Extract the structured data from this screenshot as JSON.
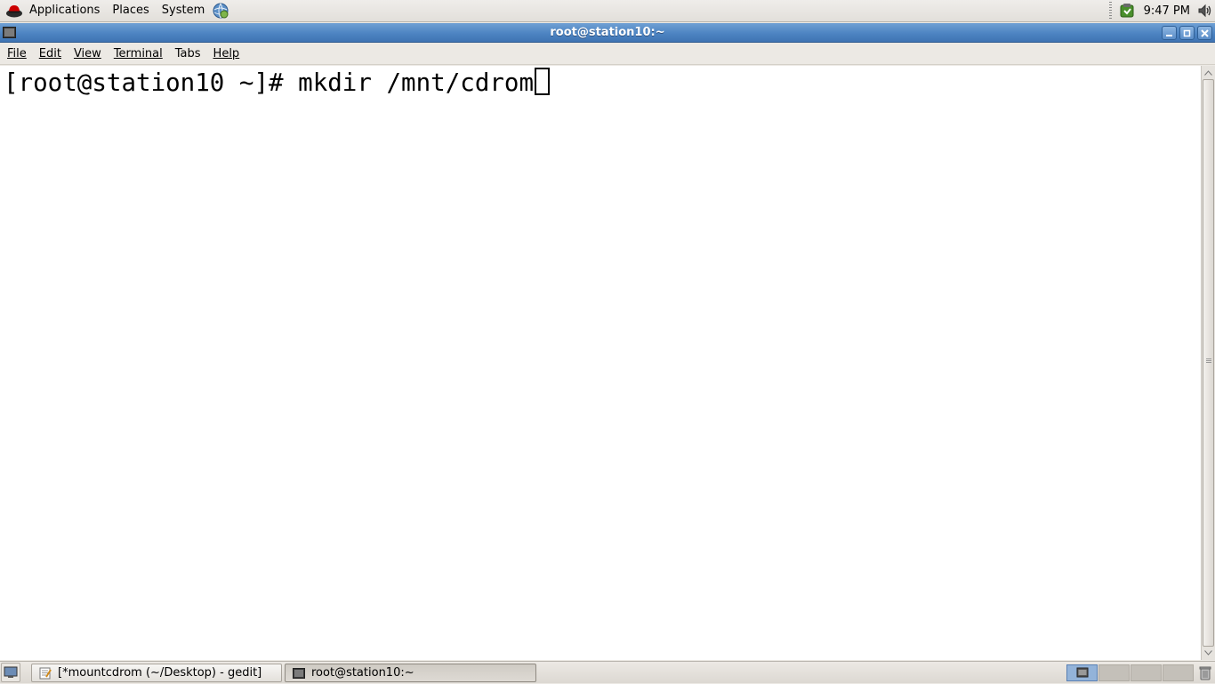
{
  "top_panel": {
    "menus": [
      "Applications",
      "Places",
      "System"
    ],
    "clock": "9:47 PM",
    "icons": [
      "redhat-logo-icon",
      "network-globe-icon",
      "update-notifier-icon",
      "volume-icon"
    ]
  },
  "window": {
    "title": "root@station10:~"
  },
  "menubar": {
    "file": "File",
    "edit": "Edit",
    "view": "View",
    "terminal": "Terminal",
    "tabs": "Tabs",
    "help": "Help"
  },
  "terminal": {
    "prompt": "[root@station10 ~]# ",
    "command": "mkdir /mnt/cdrom"
  },
  "taskbar": {
    "tasks": [
      {
        "label": "[*mountcdrom (~/Desktop) - gedit]",
        "icon": "text-editor-icon",
        "active": false
      },
      {
        "label": "root@station10:~",
        "icon": "terminal-icon",
        "active": true
      }
    ],
    "workspace_count": 4,
    "active_workspace": 1
  },
  "colors": {
    "titlebar": "#4d84c2",
    "terminal_bg": "#ffffff",
    "terminal_fg": "#000000",
    "panel_bg": "#ece9e4"
  }
}
